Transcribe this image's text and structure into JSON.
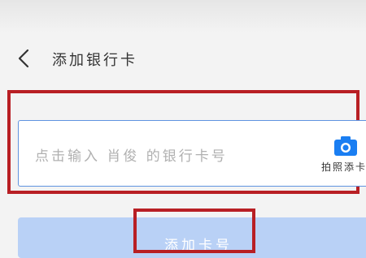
{
  "header": {
    "title": "添加银行卡",
    "back_icon": "chevron-left-icon"
  },
  "card_input": {
    "placeholder": "点击输入  肖俊  的银行卡号",
    "photo_add_label": "拍照添卡",
    "photo_add_icon": "camera-icon"
  },
  "next_button": {
    "label": "添加卡号"
  },
  "colors": {
    "accent": "#1a7ef2",
    "input_border": "#5f93e0",
    "button_disabled": "#b9d1f6",
    "highlight": "#b81f24",
    "background": "#f3f3f3"
  }
}
